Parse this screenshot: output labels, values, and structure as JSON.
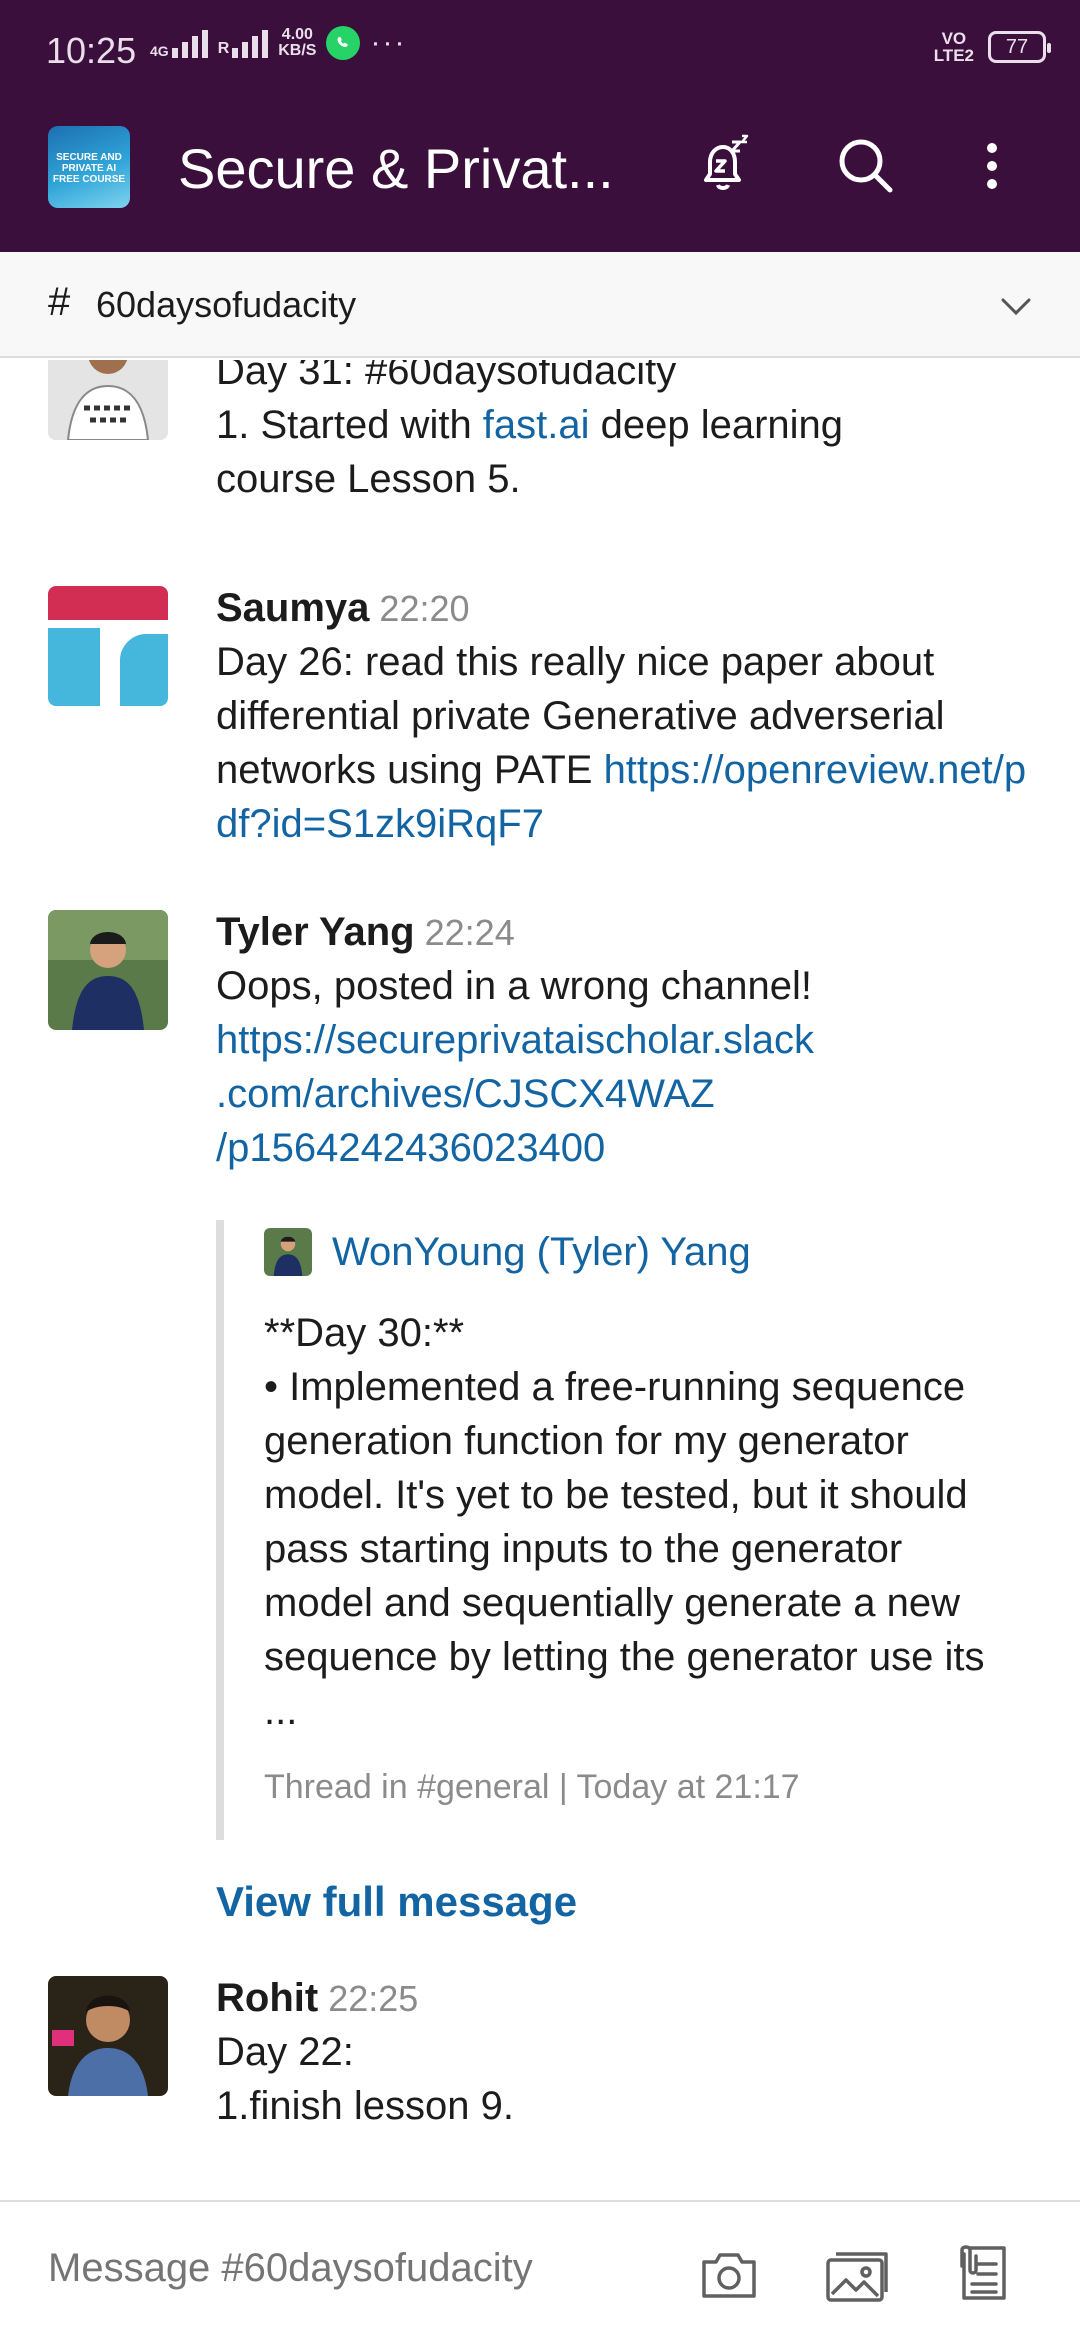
{
  "status_bar": {
    "time": "10:25",
    "net_type": "4G",
    "roaming": "R",
    "speed_value": "4.00",
    "speed_unit": "KB/S",
    "more": "···",
    "volte": "VO",
    "volte2": "LTE2",
    "battery": "77"
  },
  "header": {
    "workspace_logo_text": "SECURE AND PRIVATE AI FREE COURSE",
    "title": "Secure & Privat...",
    "icons": [
      "snooze-bell-icon",
      "search-icon",
      "more-vertical-icon"
    ]
  },
  "channel_bar": {
    "hash": "#",
    "name": "60daysofudacity"
  },
  "messages": [
    {
      "author": "",
      "time": "",
      "line1": "Day 31: #60daysofudacity",
      "line2_prefix": "1. Started with ",
      "line2_link": "fast.ai",
      "line2_suffix": " deep learning",
      "line3": "course Lesson 5."
    },
    {
      "author": "Saumya",
      "time": "22:20",
      "text": "Day 26: read this really nice paper about differential private Generative adverserial networks using PATE ",
      "link": "https://openreview.net/pdf?id=S1zk9iRqF7"
    },
    {
      "author": "Tyler Yang",
      "time": "22:24",
      "text": "Oops, posted in a wrong channel!",
      "link_line1": "https://secureprivataischolar.slack",
      "link_line2": ".com/archives/CJSCX4WAZ",
      "link_line3": "/p1564242436023400",
      "quote": {
        "author": "WonYoung (Tyler) Yang",
        "text_line1": "**Day 30:**",
        "text_rest": "• Implemented a free-running sequence generation function for my generator model. It's yet to be tested, but it should pass starting inputs to the generator model and sequentially generate a new sequence by letting the generator use its ...",
        "meta": "Thread in #general | Today at 21:17"
      },
      "view_full": "View full message"
    },
    {
      "author": "Rohit",
      "time": "22:25",
      "line1": "Day 22:",
      "line2": "1.finish lesson 9."
    }
  ],
  "composer": {
    "placeholder": "Message #60daysofudacity",
    "icons": [
      "camera-icon",
      "image-icon",
      "files-icon"
    ]
  },
  "colors": {
    "header_bg": "#3b0f3c",
    "link": "#1264a3",
    "muted": "#8b8b8b"
  }
}
